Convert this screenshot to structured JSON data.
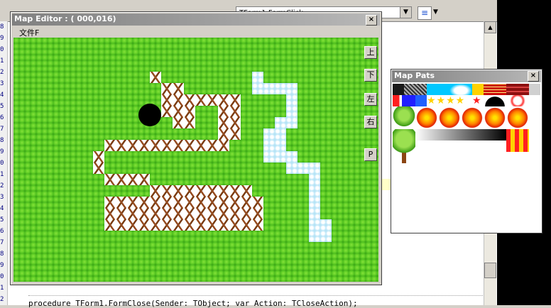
{
  "ide": {
    "combo_value": "TForm1.FormClick",
    "align_icon": "align-center-icon",
    "line_numbers": [
      "8",
      "9",
      "0",
      "1",
      "2",
      "3",
      "4",
      "5",
      "6",
      "7",
      "8",
      "9",
      "0",
      "1",
      "2",
      "3",
      "4",
      "5",
      "6",
      "7",
      "8",
      "9",
      "0",
      "1",
      "2"
    ],
    "code_line": "procedure TForm1.FormClose(Sender: TObject; var Action: TCloseAction);"
  },
  "map_editor": {
    "title": "Map Editor : ( 000,016)",
    "menu_file": "文件F",
    "close_label": "×",
    "side_buttons": [
      {
        "label": "上",
        "name": "up-button"
      },
      {
        "label": "下",
        "name": "down-button"
      },
      {
        "label": "左",
        "name": "left-button"
      },
      {
        "label": "右",
        "name": "right-button"
      },
      {
        "label": "P",
        "name": "p-button"
      }
    ],
    "tiles": {
      "grass_color": "#3bb81a",
      "tree_tile": "tree-stump",
      "water_tile": "ice-water",
      "hole_tile": "black-hole"
    }
  },
  "map_pats": {
    "title": "Map Pats",
    "close_label": "×",
    "patterns": [
      "sky",
      "brick",
      "star",
      "fire",
      "tree",
      "water",
      "hole",
      "gradient"
    ]
  }
}
